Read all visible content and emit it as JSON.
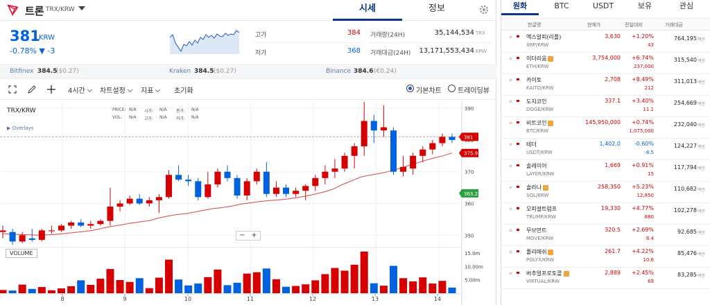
{
  "header": {
    "coin_name": "트론",
    "pair": "TRX/KRW",
    "tabs": [
      "시세",
      "정보"
    ]
  },
  "price": {
    "value": "381",
    "unit": "KRW",
    "change_pct": "-0.78%",
    "change_abs": "▼ -3"
  },
  "stats": {
    "high_label": "고가",
    "high_value": "384",
    "low_label": "저가",
    "low_value": "368",
    "volume_label": "거래량(24H)",
    "volume_value": "35,144,534",
    "volume_unit": "TRX",
    "amount_label": "거래대금(24H)",
    "amount_value": "13,171,553,434",
    "amount_unit": "KRW"
  },
  "exchanges": [
    {
      "name": "Bitfinex",
      "price": "384.5",
      "conv": "($0.27)"
    },
    {
      "name": "Kraken",
      "price": "384.5",
      "conv": "($0.27)"
    },
    {
      "name": "Binance",
      "price": "384.6",
      "conv": "(€0.24)"
    }
  ],
  "toolbar": {
    "interval": "4시간",
    "chart_settings": "차트설정",
    "indicators": "지표",
    "reset": "초기화",
    "basic_chart": "기본차트",
    "tradingview": "트레이딩뷰"
  },
  "chart_legend": {
    "symbol": "TRX/KRW",
    "overlays": "Overlays",
    "fields": [
      [
        "PRICE:",
        "N/A"
      ],
      [
        "시가:",
        "N/A"
      ],
      [
        "종가:",
        "N/A"
      ],
      [
        "VOL:",
        "N/A"
      ],
      [
        "고가:",
        "N/A"
      ],
      [
        "저가:",
        "N/A"
      ]
    ]
  },
  "chart_data": {
    "type": "candlestick",
    "symbol": "TRX/KRW",
    "x_ticks": [
      "8",
      "9",
      "10",
      "11",
      "12",
      "13",
      "14"
    ],
    "y_ticks": [
      390,
      380,
      370,
      360,
      350
    ],
    "ylim": [
      347,
      392
    ],
    "volume_ticks": [
      "15.0m",
      "10.00m",
      "5.00m"
    ],
    "volume_ylim": [
      0,
      16
    ],
    "price_tags": [
      {
        "value": 381,
        "label": "381",
        "color": "#d60000"
      },
      {
        "value": 375.9,
        "label": "375.9",
        "color": "#d60000"
      },
      {
        "value": 363.2,
        "label": "363.2",
        "color": "#2e9e3f"
      }
    ],
    "candles": [
      {
        "o": 351,
        "h": 353,
        "l": 349,
        "c": 351.5,
        "v": 1.2
      },
      {
        "o": 351,
        "h": 352,
        "l": 347,
        "c": 348,
        "v": 1.0
      },
      {
        "o": 348,
        "h": 351,
        "l": 347.5,
        "c": 350,
        "v": 3.2
      },
      {
        "o": 349,
        "h": 352,
        "l": 348,
        "c": 348.5,
        "v": 1.6
      },
      {
        "o": 348.5,
        "h": 352,
        "l": 348,
        "c": 351.5,
        "v": 2.3
      },
      {
        "o": 351.5,
        "h": 353,
        "l": 350.5,
        "c": 351.5,
        "v": 1.1
      },
      {
        "o": 351.5,
        "h": 353.5,
        "l": 351,
        "c": 353,
        "v": 1.8
      },
      {
        "o": 353,
        "h": 354.5,
        "l": 352,
        "c": 354,
        "v": 2.6
      },
      {
        "o": 354,
        "h": 355,
        "l": 352.5,
        "c": 353,
        "v": 4.8
      },
      {
        "o": 353,
        "h": 354.5,
        "l": 352,
        "c": 353.5,
        "v": 3.1
      },
      {
        "o": 353.5,
        "h": 355,
        "l": 353,
        "c": 354.5,
        "v": 5.4
      },
      {
        "o": 354.5,
        "h": 365,
        "l": 353,
        "c": 359,
        "v": 9.0
      },
      {
        "o": 359,
        "h": 361,
        "l": 357.5,
        "c": 360,
        "v": 4.9
      },
      {
        "o": 360,
        "h": 362.5,
        "l": 359.5,
        "c": 361.5,
        "v": 4.2
      },
      {
        "o": 361.5,
        "h": 363,
        "l": 359.5,
        "c": 360,
        "v": 5.6
      },
      {
        "o": 360,
        "h": 362,
        "l": 359,
        "c": 361,
        "v": 1.9
      },
      {
        "o": 361,
        "h": 363,
        "l": 357,
        "c": 362,
        "v": 5.8
      },
      {
        "o": 362,
        "h": 370.5,
        "l": 361.5,
        "c": 369,
        "v": 12.5
      },
      {
        "o": 369,
        "h": 372,
        "l": 367,
        "c": 367.5,
        "v": 5.1
      },
      {
        "o": 367.5,
        "h": 369,
        "l": 365.5,
        "c": 367,
        "v": 2.9
      },
      {
        "o": 367,
        "h": 368,
        "l": 361,
        "c": 362,
        "v": 3.6
      },
      {
        "o": 362,
        "h": 370,
        "l": 361.5,
        "c": 366,
        "v": 6.0
      },
      {
        "o": 366,
        "h": 371,
        "l": 365,
        "c": 370,
        "v": 8.8
      },
      {
        "o": 370,
        "h": 372,
        "l": 367,
        "c": 368,
        "v": 3.0
      },
      {
        "o": 368,
        "h": 369,
        "l": 361.5,
        "c": 362.5,
        "v": 3.9
      },
      {
        "o": 362.5,
        "h": 368,
        "l": 361,
        "c": 367,
        "v": 7.3
      },
      {
        "o": 367,
        "h": 371,
        "l": 366,
        "c": 370,
        "v": 7.8
      },
      {
        "o": 370,
        "h": 373,
        "l": 362,
        "c": 363,
        "v": 9.2
      },
      {
        "o": 363,
        "h": 367,
        "l": 362,
        "c": 365,
        "v": 5.2
      },
      {
        "o": 365,
        "h": 366,
        "l": 362,
        "c": 363,
        "v": 2.4
      },
      {
        "o": 363,
        "h": 365,
        "l": 362,
        "c": 364,
        "v": 2.7
      },
      {
        "o": 364,
        "h": 366,
        "l": 361,
        "c": 365.5,
        "v": 3.3
      },
      {
        "o": 365.5,
        "h": 369,
        "l": 364,
        "c": 368,
        "v": 4.8
      },
      {
        "o": 368,
        "h": 372,
        "l": 366,
        "c": 370,
        "v": 7.1
      },
      {
        "o": 370,
        "h": 374,
        "l": 368,
        "c": 371,
        "v": 9.4
      },
      {
        "o": 371,
        "h": 376,
        "l": 370,
        "c": 375,
        "v": 8.4
      },
      {
        "o": 375,
        "h": 379,
        "l": 371,
        "c": 378,
        "v": 10.6
      },
      {
        "o": 378,
        "h": 392,
        "l": 375,
        "c": 386,
        "v": 15.5
      },
      {
        "o": 386,
        "h": 388,
        "l": 379,
        "c": 383,
        "v": 3.7
      },
      {
        "o": 383,
        "h": 391,
        "l": 381,
        "c": 384,
        "v": 2.8
      },
      {
        "o": 383,
        "h": 384,
        "l": 369,
        "c": 370,
        "v": 10.2
      },
      {
        "o": 370,
        "h": 375,
        "l": 368.5,
        "c": 371.5,
        "v": 5.6
      },
      {
        "o": 371,
        "h": 376,
        "l": 369,
        "c": 375,
        "v": 4.4
      },
      {
        "o": 375,
        "h": 378,
        "l": 373,
        "c": 377,
        "v": 5.9
      },
      {
        "o": 377,
        "h": 380,
        "l": 375.5,
        "c": 379,
        "v": 3.6
      },
      {
        "o": 379,
        "h": 382,
        "l": 378,
        "c": 381,
        "v": 4.6
      },
      {
        "o": 381,
        "h": 382,
        "l": 379,
        "c": 380,
        "v": 2.1
      }
    ],
    "ma": [
      350.5,
      350.3,
      350.2,
      350.1,
      350.0,
      350.1,
      350.3,
      350.6,
      350.9,
      351.2,
      351.6,
      352.3,
      352.8,
      353.3,
      353.8,
      354.2,
      354.6,
      355.4,
      356.0,
      356.5,
      356.8,
      357.3,
      357.9,
      358.4,
      358.7,
      359.2,
      359.8,
      360.2,
      360.6,
      360.9,
      361.1,
      361.4,
      361.8,
      362.3,
      362.9,
      363.6,
      364.5,
      365.9,
      367.1,
      368.3,
      368.9,
      369.4,
      370.0,
      370.8,
      371.7,
      372.6,
      373.5,
      374.3,
      375.0,
      375.9
    ]
  },
  "market": {
    "tabs": [
      "원화",
      "BTC",
      "USDT",
      "보유",
      "관심"
    ],
    "headers": [
      "한글명",
      "현재가",
      "전일대비",
      "거래대금"
    ],
    "rows": [
      {
        "name": "엑스알피(리플)",
        "pair": "XRP/KRW",
        "price": "3,630",
        "pct": "+1.20%",
        "abs": "43",
        "vol": "764,195",
        "unit": "백만",
        "up": true,
        "badge": false
      },
      {
        "name": "이더리움",
        "pair": "ETH/KRW",
        "price": "3,754,000",
        "pct": "+6.74%",
        "abs": "237,000",
        "vol": "315,540",
        "unit": "백만",
        "up": true,
        "badge": true
      },
      {
        "name": "카이토",
        "pair": "KAITO/KRW",
        "price": "2,708",
        "pct": "+8.49%",
        "abs": "212",
        "vol": "311,013",
        "unit": "백만",
        "up": true,
        "badge": false
      },
      {
        "name": "도지코인",
        "pair": "DOGE/KRW",
        "price": "337.1",
        "pct": "+3.40%",
        "abs": "11.1",
        "vol": "254,669",
        "unit": "백만",
        "up": true,
        "badge": false
      },
      {
        "name": "비트코인",
        "pair": "BTC/KRW",
        "price": "145,950,000",
        "pct": "+0.74%",
        "abs": "1,075,000",
        "vol": "232,040",
        "unit": "백만",
        "up": true,
        "badge": true
      },
      {
        "name": "테더",
        "pair": "USDT/KRW",
        "price": "1,402.0",
        "pct": "-0.60%",
        "abs": "-8.5",
        "vol": "124,227",
        "unit": "백만",
        "up": false,
        "badge": false
      },
      {
        "name": "솔레이어",
        "pair": "LAYER/KRW",
        "price": "1,669",
        "pct": "+0.91%",
        "abs": "15",
        "vol": "117,794",
        "unit": "백만",
        "up": true,
        "badge": false
      },
      {
        "name": "솔라나",
        "pair": "SOL/KRW",
        "price": "258,350",
        "pct": "+5.23%",
        "abs": "12,850",
        "vol": "110,682",
        "unit": "백만",
        "up": true,
        "badge": true
      },
      {
        "name": "오피셜트럼프",
        "pair": "TRUMP/KRW",
        "price": "19,330",
        "pct": "+4.77%",
        "abs": "880",
        "vol": "102,278",
        "unit": "백만",
        "up": true,
        "badge": false
      },
      {
        "name": "무브먼트",
        "pair": "MOVE/KRW",
        "price": "320.5",
        "pct": "+2.69%",
        "abs": "8.4",
        "vol": "92,685",
        "unit": "백만",
        "up": true,
        "badge": false
      },
      {
        "name": "폴리매쉬",
        "pair": "POLYX/KRW",
        "price": "261.7",
        "pct": "+4.22%",
        "abs": "10.6",
        "vol": "85,476",
        "unit": "백만",
        "up": true,
        "badge": true
      },
      {
        "name": "버추얼프로토콜",
        "pair": "VIRTUAL/KRW",
        "price": "2,889",
        "pct": "+2.45%",
        "abs": "69",
        "vol": "83,285",
        "unit": "백만",
        "up": true,
        "badge": true
      }
    ]
  },
  "colors": {
    "up": "#d60000",
    "down": "#0062df",
    "accent": "#093687",
    "ma": "#d64545"
  }
}
